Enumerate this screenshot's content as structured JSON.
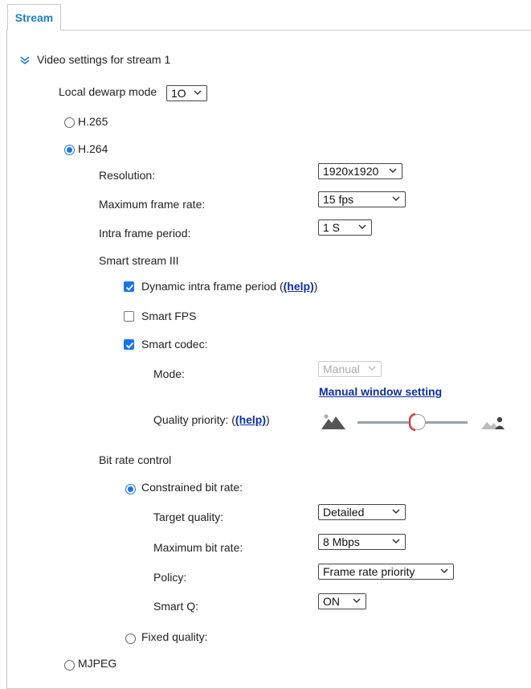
{
  "tab": {
    "label": "Stream"
  },
  "section": {
    "title": "Video settings for stream 1"
  },
  "dewarp": {
    "label": "Local dewarp mode",
    "value": "1O"
  },
  "codecs": {
    "h265": {
      "label": "H.265",
      "selected": false
    },
    "h264": {
      "label": "H.264",
      "selected": true
    },
    "mjpeg": {
      "label": "MJPEG",
      "selected": false
    }
  },
  "h264": {
    "resolution": {
      "label": "Resolution:",
      "value": "1920x1920"
    },
    "max_frame_rate": {
      "label": "Maximum frame rate:",
      "value": "15 fps"
    },
    "intra_frame_period": {
      "label": "Intra frame period:",
      "value": "1 S"
    },
    "smart_stream": {
      "title": "Smart stream III",
      "dynamic_intra": {
        "label": "Dynamic intra frame period (",
        "help": "(help)",
        "suffix": ")",
        "checked": true
      },
      "smart_fps": {
        "label": "Smart FPS",
        "checked": false
      },
      "smart_codec": {
        "label": "Smart codec:",
        "checked": true
      },
      "mode": {
        "label": "Mode:",
        "value": "Manual"
      },
      "manual_window_link": "Manual window setting",
      "quality_priority": {
        "label": "Quality priority: (",
        "help": "(help)",
        "suffix": ")",
        "level": 0.5
      }
    },
    "bit_rate": {
      "title": "Bit rate control",
      "constrained": {
        "label": "Constrained bit rate:",
        "selected": true
      },
      "target_quality": {
        "label": "Target quality:",
        "value": "Detailed"
      },
      "max_bit_rate": {
        "label": "Maximum bit rate:",
        "value": "8 Mbps"
      },
      "policy": {
        "label": "Policy:",
        "value": "Frame rate priority"
      },
      "smart_q": {
        "label": "Smart Q:",
        "value": "ON"
      },
      "fixed": {
        "label": "Fixed quality:",
        "selected": false
      }
    }
  },
  "colors": {
    "accent": "#1a73e8",
    "tab_text": "#1f7fc4",
    "link": "#0d2fa0"
  }
}
